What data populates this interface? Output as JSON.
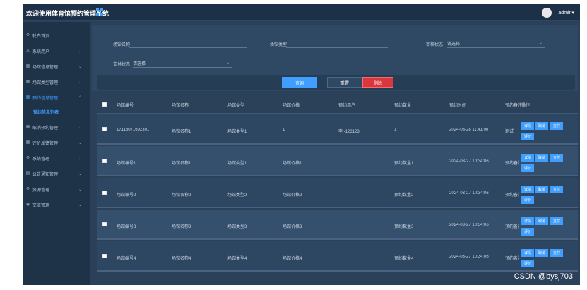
{
  "header": {
    "title": "欢迎使用体育馆预约管理系统",
    "user": "admin"
  },
  "sidebar": {
    "items": [
      {
        "label": "轮白首页",
        "icon": "gear-icon",
        "glyph": "⚙",
        "chevron": false
      },
      {
        "label": "系统用户",
        "icon": "user-icon",
        "glyph": "♙",
        "chevron": true
      },
      {
        "label": "场馆信息管理",
        "icon": "grid-icon",
        "glyph": "▦",
        "chevron": true
      },
      {
        "label": "场馆类型管理",
        "icon": "grid-icon",
        "glyph": "▦",
        "chevron": true
      },
      {
        "label": "预约信息管理",
        "icon": "grid-icon",
        "glyph": "▦",
        "chevron": true,
        "active": true
      },
      {
        "label": "取消预约管理",
        "icon": "grid-icon",
        "glyph": "▦",
        "chevron": true
      },
      {
        "label": "评价反馈管理",
        "icon": "grid-icon",
        "glyph": "▦",
        "chevron": true
      },
      {
        "label": "系统管理",
        "icon": "gear-icon",
        "glyph": "⚙",
        "chevron": true
      },
      {
        "label": "公告通知管理",
        "icon": "doc-icon",
        "glyph": "▤",
        "chevron": true
      },
      {
        "label": "资源管理",
        "icon": "gear-icon",
        "glyph": "⚙",
        "chevron": true
      },
      {
        "label": "交流管理",
        "icon": "chat-icon",
        "glyph": "◉",
        "chevron": true
      }
    ],
    "sub_item": "预约信息列表"
  },
  "search": {
    "field1_label": "场馆名称",
    "field2_label": "场馆类型",
    "field3_label": "审核状态",
    "field3_value": "请选择",
    "field4_label": "支付状态",
    "field4_value": "请选择",
    "search_button": "查询",
    "reset_button": "重置",
    "delete_button": "删除"
  },
  "table": {
    "columns": [
      "场馆编号",
      "场馆名称",
      "场馆类型",
      "场馆价格",
      "预约用户",
      "预约数量",
      "预约时间",
      "预约备注",
      "操作"
    ],
    "rows": [
      [
        "17115071692301",
        "场馆名称1",
        "场馆类型1",
        "1",
        "李 -123123",
        "1",
        "2024-03-28 11:41:00",
        "测试"
      ],
      [
        "场馆编号1",
        "场馆名称1",
        "场馆类型1",
        "场馆价格1",
        "",
        "预约数量1",
        "2024-03-27 10:34:06",
        "预约备注1"
      ],
      [
        "场馆编号2",
        "场馆名称2",
        "场馆类型2",
        "场馆价格2",
        "",
        "预约数量2",
        "2024-03-27 10:34:06",
        "预约备注2"
      ],
      [
        "场馆编号3",
        "场馆名称3",
        "场馆类型3",
        "场馆价格3",
        "",
        "预约数量3",
        "2024-03-27 10:34:06",
        "预约备注3"
      ],
      [
        "场馆编号4",
        "场馆名称4",
        "场馆类型4",
        "场馆价格4",
        "",
        "预约数量4",
        "2024-03-27 10:34:06",
        "预约备注4"
      ]
    ],
    "actions": [
      "详情",
      "取消",
      "支付",
      "评价"
    ]
  },
  "watermark": "CSDN @bysj703",
  "colors": {
    "primary": "#409eff",
    "danger": "#d9363e",
    "background": "#2a4159",
    "sidebar": "#1e3348"
  }
}
